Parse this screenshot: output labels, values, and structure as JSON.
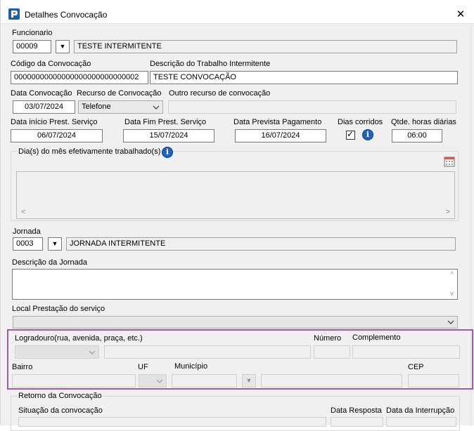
{
  "window": {
    "title": "Detalhes Convocação",
    "close_glyph": "✕"
  },
  "funcionario": {
    "label": "Funcionario",
    "code": "00009",
    "name": "TESTE INTERMITENTE"
  },
  "codigo": {
    "label": "Código da Convocação",
    "value": "00000000000000000000000000002"
  },
  "descricao_trabalho": {
    "label": "Descrição do Trabalho Intermitente",
    "value": "TESTE CONVOCAÇÃO"
  },
  "data_convocacao": {
    "label": "Data Convocação",
    "value": "03/07/2024"
  },
  "recurso": {
    "label": "Recurso de Convocação",
    "value": "Telefone"
  },
  "outro_recurso": {
    "label": "Outro recurso de convocação",
    "value": ""
  },
  "data_inicio": {
    "label": "Data início Prest. Serviço",
    "value": "06/07/2024"
  },
  "data_fim": {
    "label": "Data Fim Prest. Serviço",
    "value": "15/07/2024"
  },
  "data_prevista": {
    "label": "Data Prevista Pagamento",
    "value": "16/07/2024"
  },
  "dias_corridos": {
    "label": "Dias corridos",
    "checked": true,
    "check_glyph": "✓"
  },
  "qtde_horas": {
    "label": "Qtde. horas diárias",
    "value": "06:00"
  },
  "dias_mes": {
    "label": "Dia(s) do mês efetivamente trabalhado(s)",
    "scroll_left": "<",
    "scroll_right": ">"
  },
  "jornada": {
    "label": "Jornada",
    "code": "0003",
    "name": "JORNADA INTERMITENTE"
  },
  "descricao_jornada": {
    "label": "Descrição da Jornada",
    "scroll_up": "^",
    "scroll_down": "v"
  },
  "local": {
    "label": "Local Prestação do serviço",
    "value": "",
    "logradouro_label": "Logradouro(rua, avenida, praça, etc.)",
    "numero_label": "Número",
    "complemento_label": "Complemento",
    "bairro_label": "Bairro",
    "uf_label": "UF",
    "municipio_label": "Município",
    "cep_label": "CEP"
  },
  "retorno": {
    "group_label": "Retorno da Convocação",
    "situacao_label": "Situação da convocação",
    "data_resposta_label": "Data Resposta",
    "data_interrupcao_label": "Data da Interrupção"
  },
  "icons": {
    "info": "i",
    "lookup": "▼"
  },
  "colors": {
    "highlight_frame": "#a05ab0",
    "app_icon": "#1d5fa8",
    "info_icon": "#1e63c4"
  }
}
